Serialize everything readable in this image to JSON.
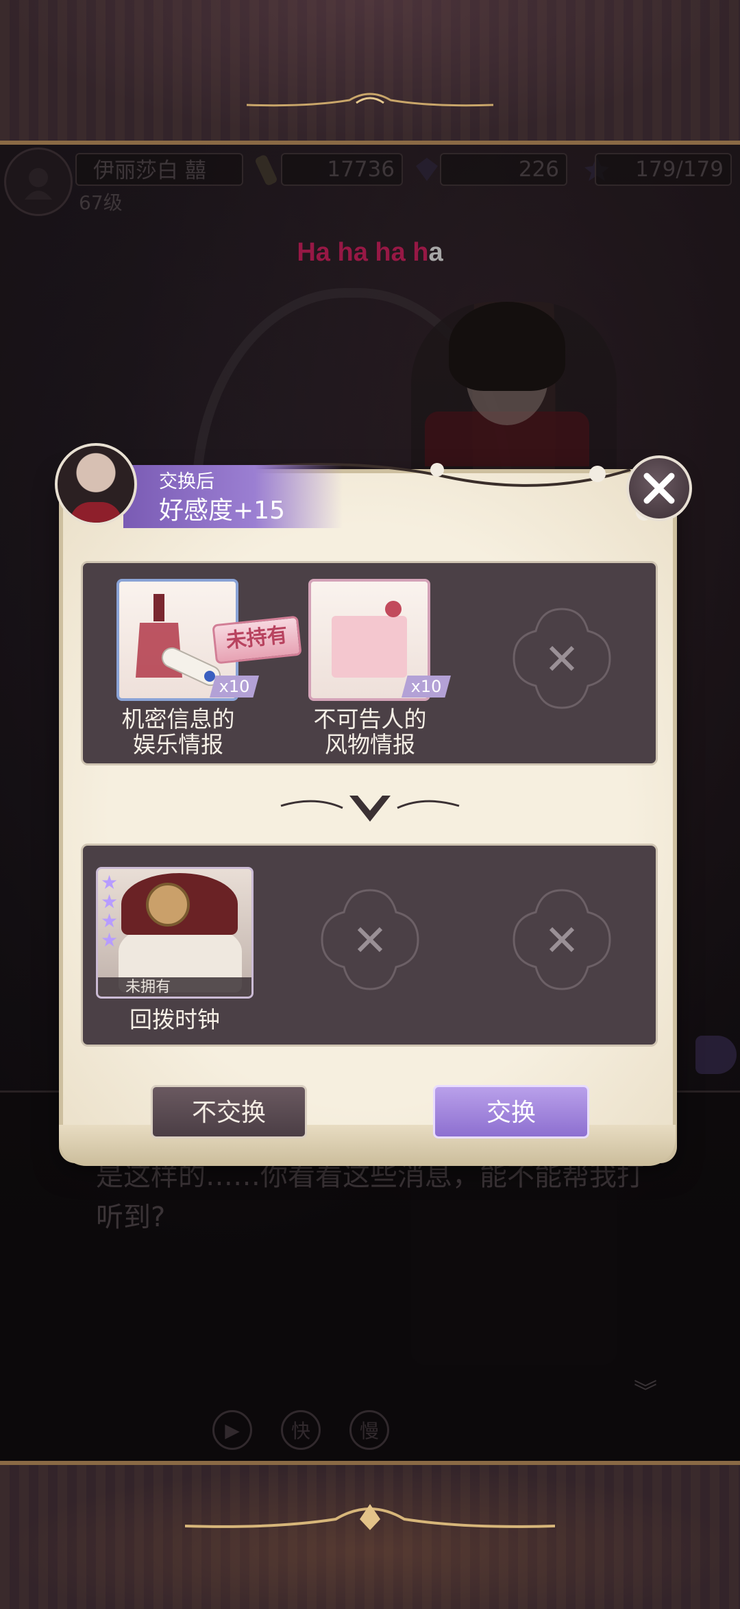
{
  "hud": {
    "player_name": "伊丽莎白 囍",
    "level": "67级",
    "gold": "17736",
    "gems": "226",
    "stamina": "179/179"
  },
  "narration": {
    "text_pink": "Ha ha ha h",
    "text_white": "a"
  },
  "dialogue": {
    "text": "是这样的……你看看这些消息，能不能帮我打听到?"
  },
  "controls": {
    "auto_icon": "play-icon",
    "fast_label": "快",
    "slow_label": "慢"
  },
  "modal": {
    "subtitle": "交换后",
    "affinity": "好感度+15",
    "close_icon": "close-icon",
    "offer_items": [
      {
        "name_line1": "机密信息的",
        "name_line2": "娱乐情报",
        "qty": "x10",
        "owned": true
      },
      {
        "name_line1": "不可告人的",
        "name_line2": "风物情报",
        "qty": "x10",
        "owned": false,
        "stamp": "未持有"
      }
    ],
    "reward_items": [
      {
        "name": "回拨时钟",
        "status": "未拥有",
        "stars": 4
      }
    ],
    "decline_label": "不交换",
    "accept_label": "交换"
  },
  "colors": {
    "narration_pink": "#e8266a",
    "accent_purple": "#9b7fd2",
    "panel_bg": "#4b4046",
    "parchment": "#f6efdf"
  }
}
